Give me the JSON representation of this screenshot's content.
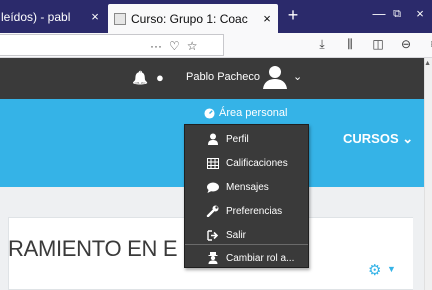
{
  "browser": {
    "tabs": [
      {
        "title": "leídos) - pabl",
        "close": "×"
      },
      {
        "title": "Curso: Grupo 1: Coac",
        "close": "×"
      }
    ],
    "new_tab": "+",
    "window": {
      "minimize": "—",
      "restore": "⧉",
      "close": "×"
    },
    "toolbar": {
      "more": "···",
      "pocket": "♡",
      "bookmark": "☆",
      "download": "⤓",
      "library": "⫼",
      "sidebar": "◫",
      "account": "⊖",
      "menu": "≡"
    }
  },
  "navbar": {
    "notifications_icon": "🔔",
    "messages_icon": "●",
    "user_name": "Pablo Pacheco",
    "caret": "⌄"
  },
  "header": {
    "area_personal": "Área personal",
    "cursos": "CURSOS ⌄"
  },
  "user_menu": {
    "items": [
      {
        "label": "Perfil",
        "icon": "user-icon"
      },
      {
        "label": "Calificaciones",
        "icon": "table-icon"
      },
      {
        "label": "Mensajes",
        "icon": "chat-icon"
      },
      {
        "label": "Preferencias",
        "icon": "wrench-icon"
      },
      {
        "label": "Salir",
        "icon": "sign-out-icon"
      },
      {
        "label": "Cambiar rol a...",
        "icon": "user-secret-icon"
      }
    ]
  },
  "page": {
    "course_title": "RAMIENTO EN E",
    "settings_icon": "gear-icon"
  },
  "colors": {
    "accent": "#35b3e7",
    "navbar": "#3a3a3a",
    "browser_tabs": "#2b2a6b"
  }
}
